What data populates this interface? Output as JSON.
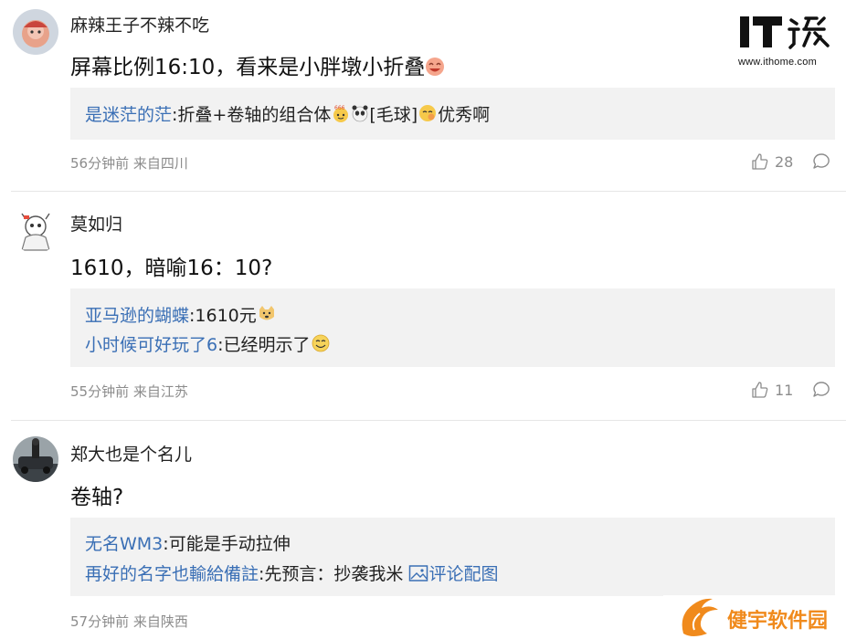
{
  "logo": {
    "url": "www.ithome.com"
  },
  "watermark": {
    "text": "健宇软件园"
  },
  "comments": [
    {
      "user": "麻辣王子不辣不吃",
      "content": "屏幕比例16:10，看来是小胖墩小折叠",
      "replies": [
        {
          "name": "是迷茫的茫",
          "sep": ":",
          "text1": "折叠+卷轴的组合体",
          "tag": "[毛球]",
          "text2": "优秀啊"
        }
      ],
      "time": "56分钟前",
      "location": "来自四川",
      "likes": "28"
    },
    {
      "user": "莫如归",
      "content": "1610，暗喻16：10?",
      "replies": [
        {
          "name": "亚马逊的蝴蝶",
          "sep": ":",
          "text1": "1610元"
        },
        {
          "name": "小时候可好玩了6",
          "sep": ":",
          "text1": "已经明示了"
        }
      ],
      "time": "55分钟前",
      "location": "来自江苏",
      "likes": "11"
    },
    {
      "user": "郑大也是个名儿",
      "content": "卷轴?",
      "replies": [
        {
          "name": "无名WM3",
          "sep": ":",
          "text1": "可能是手动拉伸"
        },
        {
          "name": "再好的名字也輸給備註",
          "sep": ":",
          "text1": "先预言：抄袭我米",
          "link": "评论配图"
        }
      ],
      "time": "57分钟前",
      "location": "来自陕西"
    }
  ],
  "colors": {
    "reply_name": "#3a6fb5",
    "meta": "#8c8c8c",
    "reply_bg": "#f2f2f2",
    "watermark": "#f08a1c"
  }
}
